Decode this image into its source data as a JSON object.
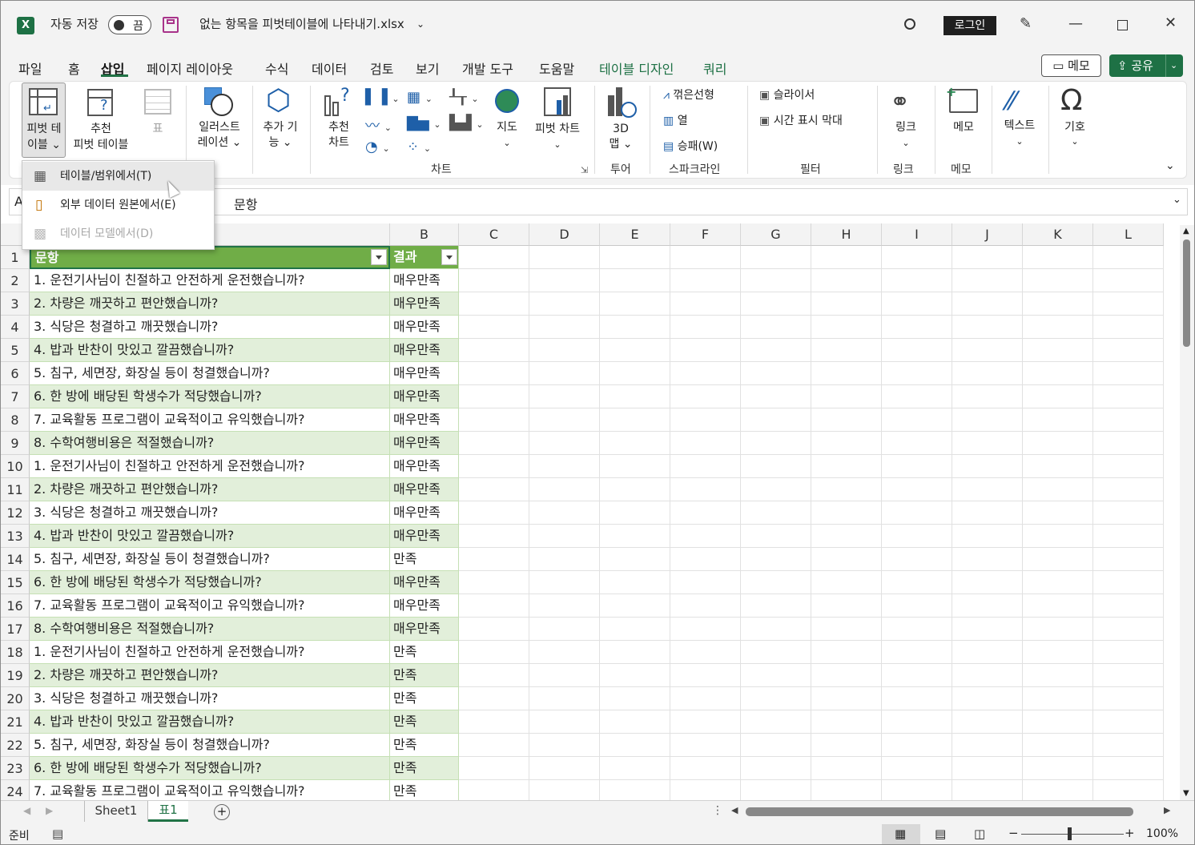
{
  "titlebar": {
    "autosave_label": "자동 저장",
    "autosave_state": "끔",
    "filename": "없는 항목을 피벗테이블에 나타내기.xlsx",
    "login": "로그인"
  },
  "menu": {
    "items": [
      "파일",
      "홈",
      "삽입",
      "페이지 레이아웃",
      "수식",
      "데이터",
      "검토",
      "보기",
      "개발 도구",
      "도움말",
      "테이블 디자인",
      "쿼리"
    ],
    "memo": "메모",
    "share": "공유"
  },
  "ribbon": {
    "pivot_table": "피벗 테이블",
    "pivot_table_l1": "피벗 테",
    "pivot_table_l2": "이블",
    "rec_pivot_l1": "추천",
    "rec_pivot_l2": "피벗 테이블",
    "table": "표",
    "illustrations_l1": "일러스트",
    "illustrations_l2": "레이션",
    "addins_l1": "추가 기",
    "addins_l2": "능",
    "rec_chart_l1": "추천",
    "rec_chart_l2": "차트",
    "map": "지도",
    "pivot_chart": "피벗 차트",
    "map3d_l1": "3D",
    "map3d_l2": "맵",
    "spark_line": "꺾은선형",
    "spark_col": "열",
    "spark_wl": "승패(W)",
    "slicer": "슬라이서",
    "timeline": "시간 표시 막대",
    "link": "링크",
    "comment": "메모",
    "text": "텍스트",
    "symbol": "기호",
    "groups": {
      "chart": "차트",
      "tour": "투어",
      "sparkline": "스파크라인",
      "filter": "필터",
      "link": "링크",
      "comment": "메모"
    }
  },
  "dropdown": {
    "items": [
      {
        "label": "테이블/범위에서(T)"
      },
      {
        "label": "외부 데이터 원본에서(E)"
      },
      {
        "label": "데이터 모델에서(D)"
      }
    ]
  },
  "formula": {
    "namebox": "A",
    "content": "문항"
  },
  "grid": {
    "columns": [
      "B",
      "C",
      "D",
      "E",
      "F",
      "G",
      "H",
      "I",
      "J",
      "K",
      "L"
    ],
    "header_a": "문항",
    "header_b": "결과",
    "rows": [
      {
        "n": "1"
      },
      {
        "n": "2",
        "a": "1. 운전기사님이 친절하고 안전하게 운전했습니까?",
        "b": "매우만족"
      },
      {
        "n": "3",
        "a": "2. 차량은 깨끗하고 편안했습니까?",
        "b": "매우만족"
      },
      {
        "n": "4",
        "a": "3. 식당은 청결하고 깨끗했습니까?",
        "b": "매우만족"
      },
      {
        "n": "5",
        "a": "4. 밥과 반찬이 맛있고 깔끔했습니까?",
        "b": "매우만족"
      },
      {
        "n": "6",
        "a": "5. 침구, 세면장, 화장실 등이 청결했습니까?",
        "b": "매우만족"
      },
      {
        "n": "7",
        "a": "6. 한 방에 배당된 학생수가 적당했습니까?",
        "b": "매우만족"
      },
      {
        "n": "8",
        "a": "7. 교육활동 프로그램이 교육적이고 유익했습니까?",
        "b": "매우만족"
      },
      {
        "n": "9",
        "a": "8. 수학여행비용은 적절했습니까?",
        "b": "매우만족"
      },
      {
        "n": "10",
        "a": "1. 운전기사님이 친절하고 안전하게 운전했습니까?",
        "b": "매우만족"
      },
      {
        "n": "11",
        "a": "2. 차량은 깨끗하고 편안했습니까?",
        "b": "매우만족"
      },
      {
        "n": "12",
        "a": "3. 식당은 청결하고 깨끗했습니까?",
        "b": "매우만족"
      },
      {
        "n": "13",
        "a": "4. 밥과 반찬이 맛있고 깔끔했습니까?",
        "b": "매우만족"
      },
      {
        "n": "14",
        "a": "5. 침구, 세면장, 화장실 등이 청결했습니까?",
        "b": "만족"
      },
      {
        "n": "15",
        "a": "6. 한 방에 배당된 학생수가 적당했습니까?",
        "b": "매우만족"
      },
      {
        "n": "16",
        "a": "7. 교육활동 프로그램이 교육적이고 유익했습니까?",
        "b": "매우만족"
      },
      {
        "n": "17",
        "a": "8. 수학여행비용은 적절했습니까?",
        "b": "매우만족"
      },
      {
        "n": "18",
        "a": "1. 운전기사님이 친절하고 안전하게 운전했습니까?",
        "b": "만족"
      },
      {
        "n": "19",
        "a": "2. 차량은 깨끗하고 편안했습니까?",
        "b": "만족"
      },
      {
        "n": "20",
        "a": "3. 식당은 청결하고 깨끗했습니까?",
        "b": "만족"
      },
      {
        "n": "21",
        "a": "4. 밥과 반찬이 맛있고 깔끔했습니까?",
        "b": "만족"
      },
      {
        "n": "22",
        "a": "5. 침구, 세면장, 화장실 등이 청결했습니까?",
        "b": "만족"
      },
      {
        "n": "23",
        "a": "6. 한 방에 배당된 학생수가 적당했습니까?",
        "b": "만족"
      },
      {
        "n": "24",
        "a": "7. 교육활동 프로그램이 교육적이고 유익했습니까?",
        "b": "만족"
      }
    ]
  },
  "sheets": {
    "tabs": [
      "Sheet1",
      "표1"
    ],
    "active": "표1"
  },
  "status": {
    "ready": "준비",
    "zoom": "100%"
  },
  "colors": {
    "excel_green": "#217346",
    "table_header": "#70ad47",
    "table_band": "#e2efda",
    "share": "#1e7145"
  }
}
